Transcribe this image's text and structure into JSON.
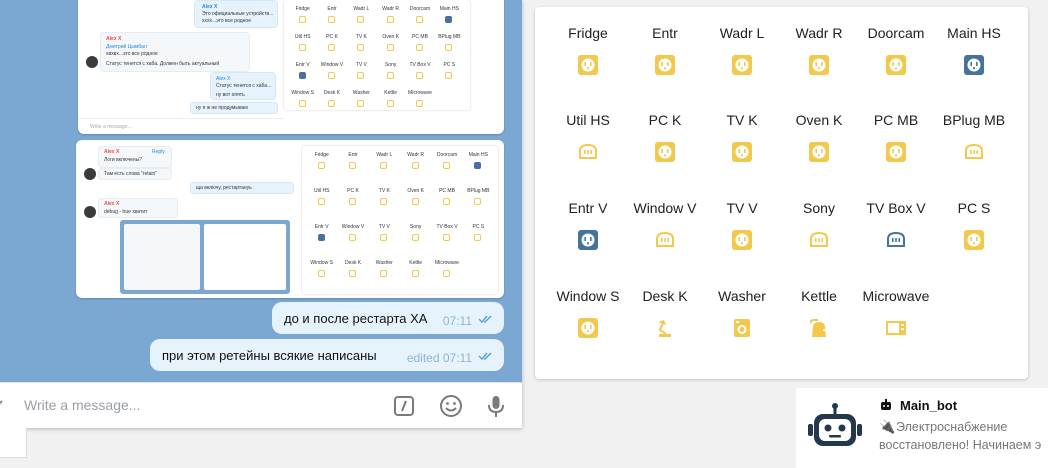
{
  "telegram": {
    "messages": [
      {
        "text": "до и после рестарта ХА",
        "time": "07:11"
      },
      {
        "text": "при этом ретейны всякие написаны",
        "time": "edited 07:11"
      }
    ],
    "input_placeholder": "Write a message..."
  },
  "shot1": {
    "lines": [
      {
        "text": "Alex X",
        "cls": "name blue"
      },
      {
        "text": "Это официальные устройств...",
        "cls": ""
      },
      {
        "text": "хххх...это все родное",
        "cls": ""
      },
      {
        "text": "Alex X",
        "cls": "name"
      },
      {
        "text": "Дмитрий Цымбал",
        "cls": "blue"
      },
      {
        "text": "хвхвх...это все родное",
        "cls": ""
      },
      {
        "text": "Статус тенется с хаба. Должен быть актуальный",
        "cls": ""
      },
      {
        "text": "Alex X",
        "cls": "blue"
      },
      {
        "text": "Статус тенется с хаба...",
        "cls": ""
      },
      {
        "text": "ну вот опять",
        "cls": ""
      },
      {
        "text": "ну я ж не продумываю",
        "cls": ""
      },
      {
        "text": "Write a message...",
        "cls": ""
      }
    ]
  },
  "shot2": {
    "lines": [
      {
        "text": "Alex X",
        "cls": "name"
      },
      {
        "text": "Reply",
        "cls": "blue"
      },
      {
        "text": "Логи включены?",
        "cls": ""
      },
      {
        "text": "Там есть слова \"retain\"",
        "cls": ""
      },
      {
        "text": "ща включу, рестартануь",
        "cls": ""
      },
      {
        "text": "Alex X",
        "cls": "name"
      },
      {
        "text": "debug - true хватит",
        "cls": ""
      }
    ]
  },
  "ha": {
    "entities": [
      {
        "name": "Fridge",
        "icon": "socket",
        "color": "#f2c94c"
      },
      {
        "name": "Entr",
        "icon": "socket",
        "color": "#f2c94c"
      },
      {
        "name": "Wadr L",
        "icon": "socket",
        "color": "#f2c94c"
      },
      {
        "name": "Wadr R",
        "icon": "socket",
        "color": "#f2c94c"
      },
      {
        "name": "Doorcam",
        "icon": "socket",
        "color": "#f2c94c"
      },
      {
        "name": "Main HS",
        "icon": "socket",
        "color": "#44739e"
      },
      {
        "name": "Util HS",
        "icon": "socket-flat",
        "color": "#f2c94c"
      },
      {
        "name": "PC K",
        "icon": "socket",
        "color": "#f2c94c"
      },
      {
        "name": "TV K",
        "icon": "socket",
        "color": "#f2c94c"
      },
      {
        "name": "Oven K",
        "icon": "socket",
        "color": "#f2c94c"
      },
      {
        "name": "PC MB",
        "icon": "socket",
        "color": "#f2c94c"
      },
      {
        "name": "BPlug MB",
        "icon": "socket-flat",
        "color": "#f2c94c"
      },
      {
        "name": "Entr V",
        "icon": "socket",
        "color": "#44739e"
      },
      {
        "name": "Window V",
        "icon": "socket-flat",
        "color": "#f2c94c"
      },
      {
        "name": "TV V",
        "icon": "socket",
        "color": "#f2c94c"
      },
      {
        "name": "Sony",
        "icon": "socket-flat",
        "color": "#f2c94c"
      },
      {
        "name": "TV Box V",
        "icon": "socket-flat",
        "color": "#44739e"
      },
      {
        "name": "PC S",
        "icon": "socket",
        "color": "#f2c94c"
      },
      {
        "name": "Window S",
        "icon": "socket",
        "color": "#f2c94c"
      },
      {
        "name": "Desk K",
        "icon": "desk-lamp",
        "color": "#f2c94c"
      },
      {
        "name": "Washer",
        "icon": "washing-machine",
        "color": "#f2c94c"
      },
      {
        "name": "Kettle",
        "icon": "kettle",
        "color": "#f2c94c"
      },
      {
        "name": "Microwave",
        "icon": "microwave",
        "color": "#f2c94c"
      }
    ]
  },
  "mini_ha": {
    "names": [
      "Fridge",
      "Entr",
      "Wadr L",
      "Wadr R",
      "Doorcam",
      "Main HS",
      "Util HS",
      "PC K",
      "TV K",
      "Oven K",
      "PC MB",
      "BPlug MB",
      "Entr V",
      "Window V",
      "TV V",
      "Sony",
      "TV Box V",
      "PC S",
      "Window S",
      "Desk K",
      "Washer",
      "Kettle",
      "Microwave"
    ]
  },
  "bot": {
    "name": "Main_bot",
    "text_line1": "Электроснабжение",
    "text_line2": "восстановлено! Начинаем э"
  },
  "colors": {
    "accent_yellow": "#f2c94c",
    "accent_blue": "#44739e",
    "chat_bg": "#7ba8d3",
    "outgoing_bubble": "#e6f3fd"
  }
}
